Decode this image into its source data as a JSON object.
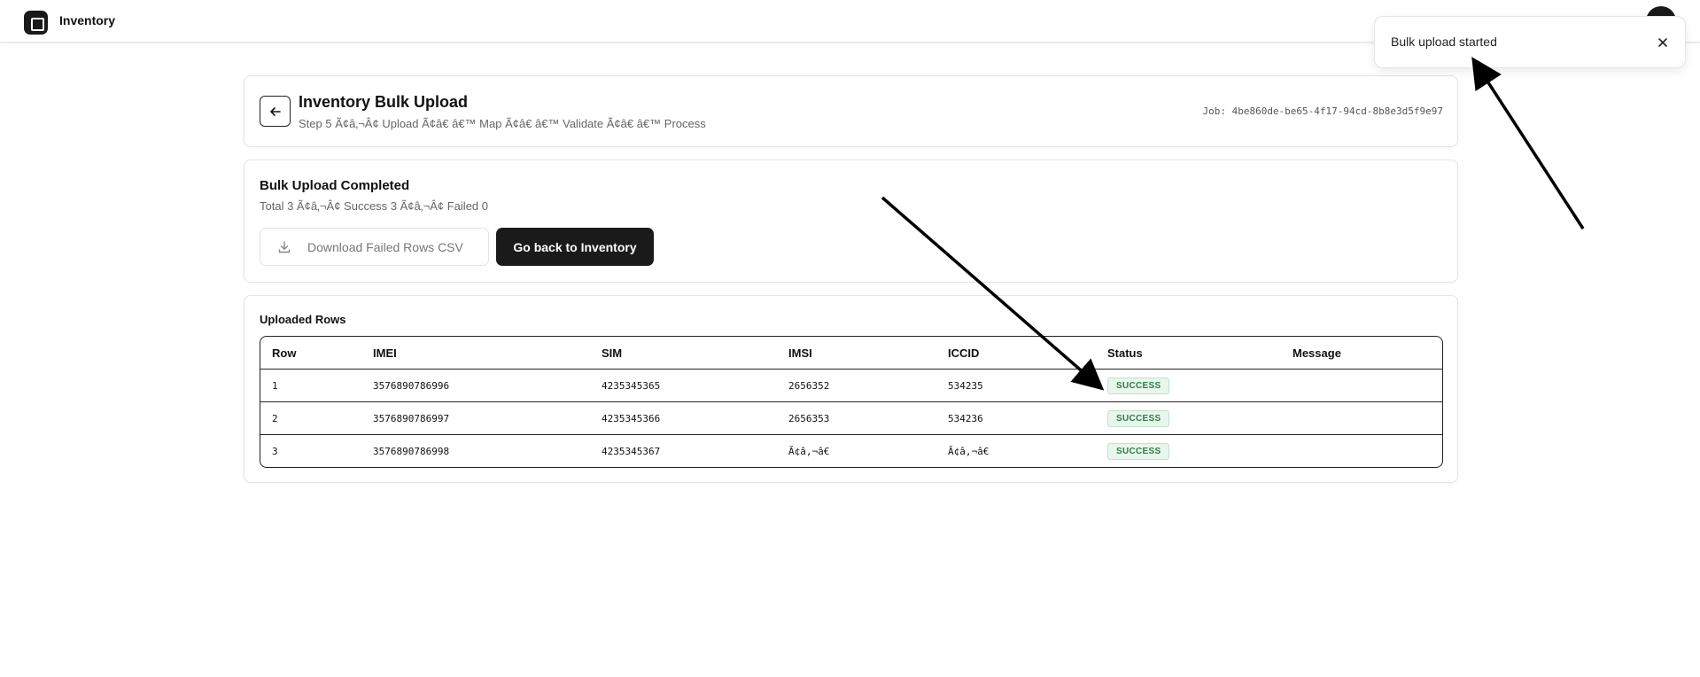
{
  "app": {
    "title": "Inventory"
  },
  "header": {
    "title": "Inventory Bulk Upload",
    "subtitle": "Step 5 Ã¢â‚¬Â¢ Upload Ã¢â€ â€™ Map Ã¢â€ â€™ Validate Ã¢â€ â€™ Process",
    "job_label": "Job: 4be860de-be65-4f17-94cd-8b8e3d5f9e97"
  },
  "summary": {
    "title": "Bulk Upload Completed",
    "subtitle": "Total 3 Ã¢â‚¬Â¢ Success 3 Ã¢â‚¬Â¢ Failed 0",
    "download_label": "Download Failed Rows CSV",
    "back_label": "Go back to Inventory"
  },
  "rows_section": {
    "title": "Uploaded Rows",
    "columns": [
      "Row",
      "IMEI",
      "SIM",
      "IMSI",
      "ICCID",
      "Status",
      "Message"
    ],
    "rows": [
      {
        "row": "1",
        "imei": "3576890786996",
        "sim": "4235345365",
        "imsi": "2656352",
        "iccid": "534235",
        "status": "SUCCESS",
        "message": ""
      },
      {
        "row": "2",
        "imei": "3576890786997",
        "sim": "4235345366",
        "imsi": "2656353",
        "iccid": "534236",
        "status": "SUCCESS",
        "message": ""
      },
      {
        "row": "3",
        "imei": "3576890786998",
        "sim": "4235345367",
        "imsi": "Ã¢â‚¬â€",
        "iccid": "Ã¢â‚¬â€",
        "status": "SUCCESS",
        "message": ""
      }
    ]
  },
  "toast": {
    "message": "Bulk upload started"
  },
  "colors": {
    "primary": "#1a1a1a",
    "success_text": "#2e7d46",
    "success_bg": "#e8f6ec",
    "border": "#e4e4e7"
  },
  "icons": {
    "logo": "square-logo-icon",
    "back": "arrow-left-icon",
    "download": "download-icon",
    "close": "close-icon"
  }
}
